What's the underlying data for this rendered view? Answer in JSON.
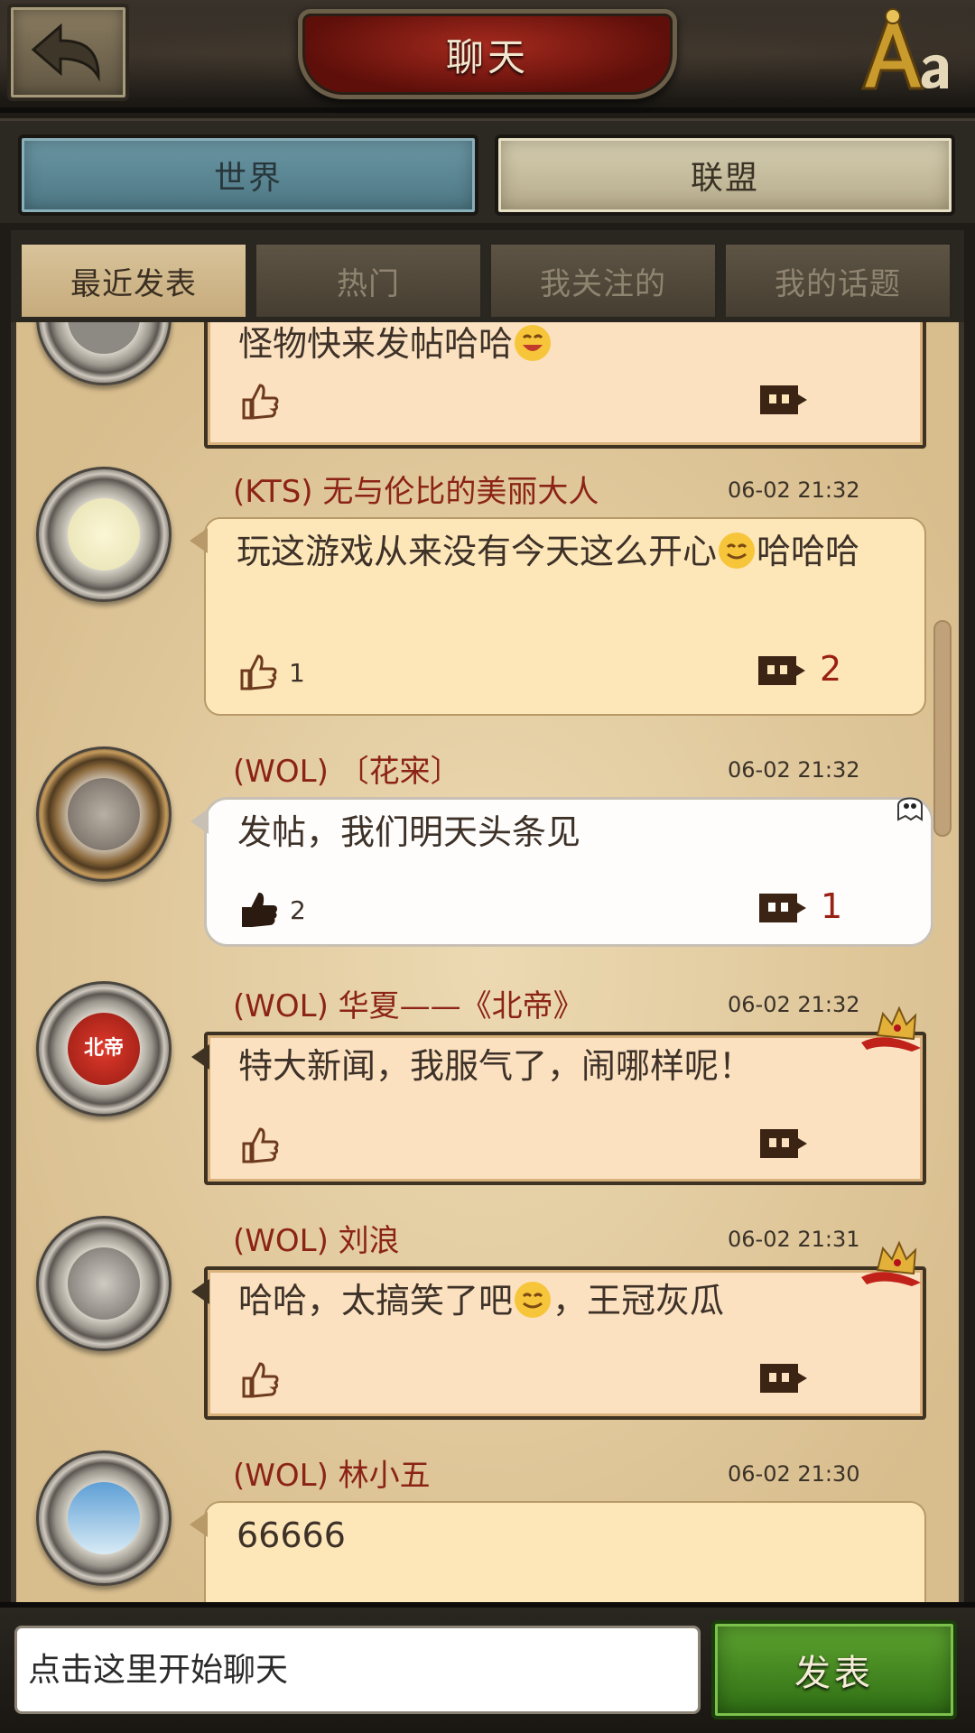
{
  "header": {
    "title": "聊天"
  },
  "main_tabs": [
    {
      "label": "世界"
    },
    {
      "label": "联盟"
    }
  ],
  "sub_tabs": [
    {
      "label": "最近发表",
      "active": true
    },
    {
      "label": "热门"
    },
    {
      "label": "我关注的"
    },
    {
      "label": "我的话题"
    }
  ],
  "posts": [
    {
      "name": "",
      "time": "",
      "message": "怪物快来发帖哈哈",
      "likes": "",
      "comments": ""
    },
    {
      "name": "(KTS) 无与伦比的美丽大人",
      "time": "06-02 21:32",
      "message_a": "玩这游戏从来没有今天这么开心",
      "message_b": "哈哈哈",
      "likes": "1",
      "comments": "2"
    },
    {
      "name": "(WOL) 〔花宩〕",
      "time": "06-02 21:32",
      "message": "发帖，我们明天头条见",
      "likes": "2",
      "comments": "1"
    },
    {
      "name": "(WOL) 华夏——《北帝》",
      "time": "06-02 21:32",
      "message": "特大新闻，我服气了，闹哪样呢！",
      "likes": "",
      "comments": "",
      "avatar_text": "北帝"
    },
    {
      "name": "(WOL) 刘浪",
      "time": "06-02 21:31",
      "message_a": "哈哈，太搞笑了吧",
      "message_b": "，王冠灰瓜",
      "likes": "",
      "comments": ""
    },
    {
      "name": "(WOL) 林小五",
      "time": "06-02 21:30",
      "message": "66666"
    }
  ],
  "footer": {
    "input_placeholder": "点击这里开始聊天",
    "send_label": "发表"
  },
  "colors": {
    "name": "#8b2316",
    "comment_count": "#9a1f14",
    "send": "#3f861f"
  }
}
